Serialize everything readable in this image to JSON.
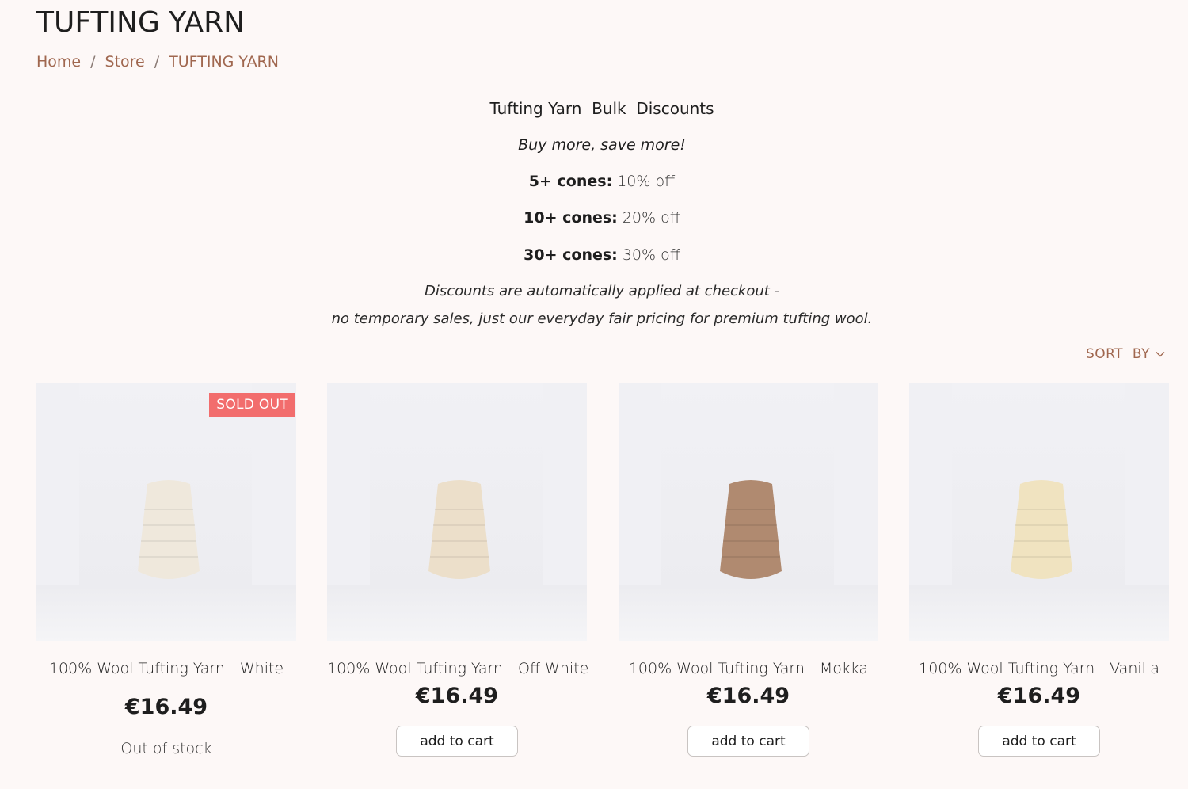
{
  "page": {
    "title": "TUFTING YARN"
  },
  "breadcrumb": {
    "home": "Home",
    "store": "Store",
    "current": "TUFTING YARN",
    "separator": "/"
  },
  "promo": {
    "heading": "Tufting Yarn  Bulk  Discounts",
    "tagline": "Buy more, save more!",
    "tiers": [
      {
        "label": "5+ cones:",
        "discount": "10% off"
      },
      {
        "label": "10+ cones:",
        "discount": "20% off"
      },
      {
        "label": "30+ cones:",
        "discount": "30% off"
      }
    ],
    "note_line1": "Discounts are automatically applied at checkout -",
    "note_line2": "no temporary sales, just our everyday fair pricing for premium tufting wool."
  },
  "sort": {
    "label": "SORT  BY",
    "icon": "chevron-down-icon"
  },
  "products": [
    {
      "name": "100% Wool Tufting Yarn - White",
      "price": "€16.49",
      "badge": "SOLD OUT",
      "status": "Out of stock",
      "yarn_color": "#efe8dc"
    },
    {
      "name": "100% Wool Tufting Yarn - Off White",
      "price": "€16.49",
      "button": "add to cart",
      "yarn_color": "#ecdfca"
    },
    {
      "name": "100% Wool Tufting Yarn-  Mokka",
      "price": "€16.49",
      "button": "add to cart",
      "yarn_color": "#b08a70"
    },
    {
      "name": "100% Wool Tufting Yarn - Vanilla",
      "price": "€16.49",
      "button": "add to cart",
      "yarn_color": "#f0e3c0"
    }
  ],
  "colors": {
    "accent": "#a0674f",
    "badge": "#f26d6d",
    "background": "#fdf8f7"
  }
}
